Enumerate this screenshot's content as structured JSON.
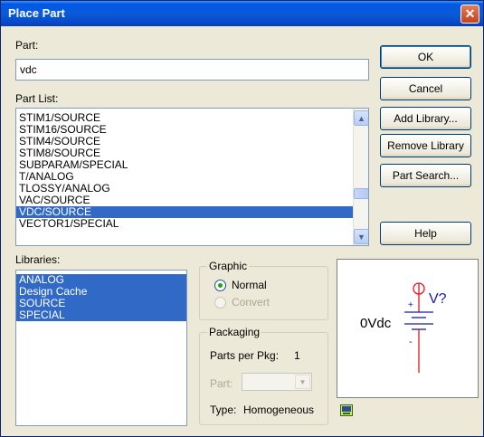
{
  "window": {
    "title": "Place Part",
    "close_glyph": "✕"
  },
  "part": {
    "label": "Part:",
    "value": "vdc"
  },
  "part_list": {
    "label": "Part List:",
    "items": [
      "STIM1/SOURCE",
      "STIM16/SOURCE",
      "STIM4/SOURCE",
      "STIM8/SOURCE",
      "SUBPARAM/SPECIAL",
      "T/ANALOG",
      "TLOSSY/ANALOG",
      "VAC/SOURCE",
      "VDC/SOURCE",
      "VECTOR1/SPECIAL"
    ],
    "selected": "VDC/SOURCE"
  },
  "libraries": {
    "label": "Libraries:",
    "items": [
      "ANALOG",
      "Design Cache",
      "SOURCE",
      "SPECIAL"
    ]
  },
  "buttons": {
    "ok": "OK",
    "cancel": "Cancel",
    "add_library": "Add Library...",
    "remove_library": "Remove Library",
    "part_search": "Part Search...",
    "help": "Help"
  },
  "graphic": {
    "label": "Graphic",
    "normal": "Normal",
    "convert": "Convert"
  },
  "packaging": {
    "label": "Packaging",
    "parts_per_pkg_label": "Parts per Pkg:",
    "parts_per_pkg_value": "1",
    "part_label": "Part:",
    "type_label": "Type:",
    "type_value": "Homogeneous"
  },
  "preview": {
    "ref": "V?",
    "value": "0Vdc",
    "plus": "+",
    "minus": "-"
  },
  "colors": {
    "accent": "#3169c6",
    "symbol_red": "#e8141c",
    "symbol_blue": "#1a1aa6"
  }
}
